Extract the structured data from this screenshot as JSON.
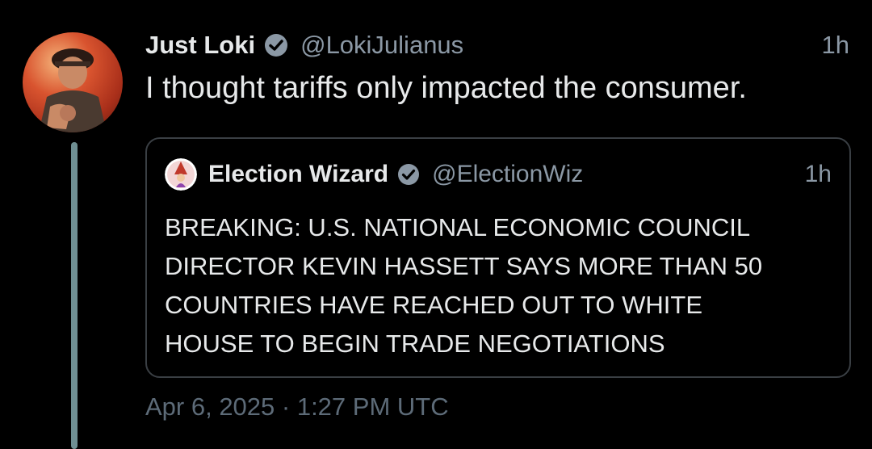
{
  "tweet": {
    "author_name": "Just Loki",
    "author_handle": "@LokiJulianus",
    "time": "1h",
    "text": "I thought tariffs only impacted the consumer.",
    "avatar_icon": "profile-avatar",
    "verified_icon": "verified-badge-icon",
    "date_footer": "Apr 6, 2025 · 1:27 PM UTC"
  },
  "quote": {
    "author_name": "Election Wizard",
    "author_handle": "@ElectionWiz",
    "time": "1h",
    "avatar_icon": "wizard-avatar",
    "verified_icon": "verified-badge-icon",
    "lines": [
      "BREAKING: U.S. NATIONAL ECONOMIC COUNCIL",
      "DIRECTOR KEVIN HASSETT SAYS MORE THAN 50",
      "COUNTRIES HAVE REACHED OUT TO WHITE",
      "HOUSE TO BEGIN TRADE NEGOTIATIONS"
    ]
  },
  "colors": {
    "background": "#000000",
    "text": "#e7e9ea",
    "muted": "#8b98a5",
    "thread_line": "#6f8f93",
    "quote_border": "#3a3f44"
  }
}
